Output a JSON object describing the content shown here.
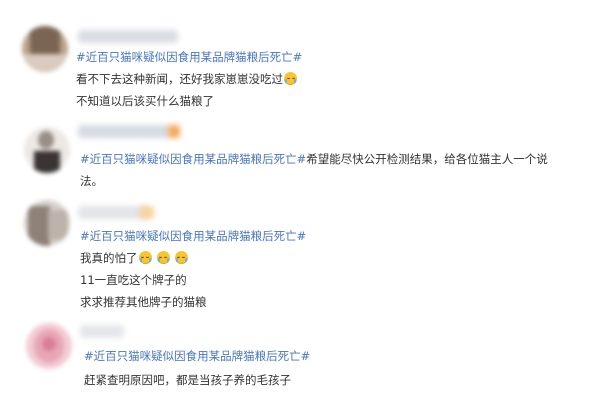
{
  "posts": [
    {
      "hashtag": "#近百只猫咪疑似因食用某品牌猫粮后死亡#",
      "lines": [
        "看不下去这种新闻，还好我家崽崽没吃过",
        "不知道以后该买什么猫粮了"
      ],
      "emoji": "crying-face-emoji"
    },
    {
      "hashtag": "#近百只猫咪疑似因食用某品牌猫粮后死亡#",
      "text_after_hashtag": "希望能尽快公开检测结果，给各位猫主人一个说",
      "continuation": "法。"
    },
    {
      "hashtag": "#近百只猫咪疑似因食用某品牌猫粮后死亡#",
      "lines": [
        "我真的怕了",
        "11一直吃这个牌子的",
        "求求推荐其他牌子的猫粮"
      ],
      "emoji": "crying-face-emoji",
      "emoji_count": 3
    },
    {
      "hashtag": "#近百只猫咪疑似因食用某品牌猫粮后死亡#",
      "lines": [
        "赶紧查明原因吧，都是当孩子养的毛孩子"
      ]
    }
  ],
  "colors": {
    "hashtag": "#4a76b8",
    "text": "#333333",
    "emoji": "#f7c531"
  }
}
